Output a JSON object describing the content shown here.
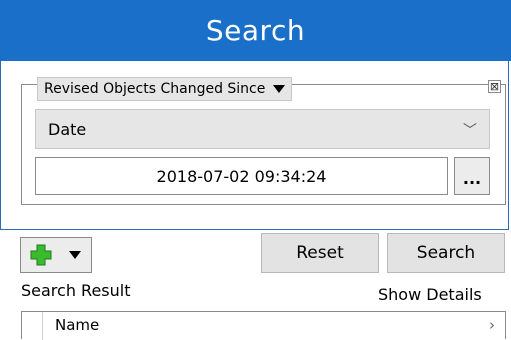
{
  "header": {
    "title": "Search"
  },
  "criteria": {
    "selected": "Revised Objects Changed Since",
    "close_glyph": "⊠",
    "field_type": "Date",
    "value": "2018-07-02 09:34:24",
    "browse_label": "..."
  },
  "toolbar": {
    "add_icon": "green-plus-icon",
    "reset_label": "Reset",
    "search_label": "Search"
  },
  "results": {
    "label": "Search Result",
    "show_details": "Show Details",
    "columns": [
      "Name"
    ]
  },
  "colors": {
    "header_bg": "#1a6fc8",
    "plus_green": "#3cba2e"
  }
}
